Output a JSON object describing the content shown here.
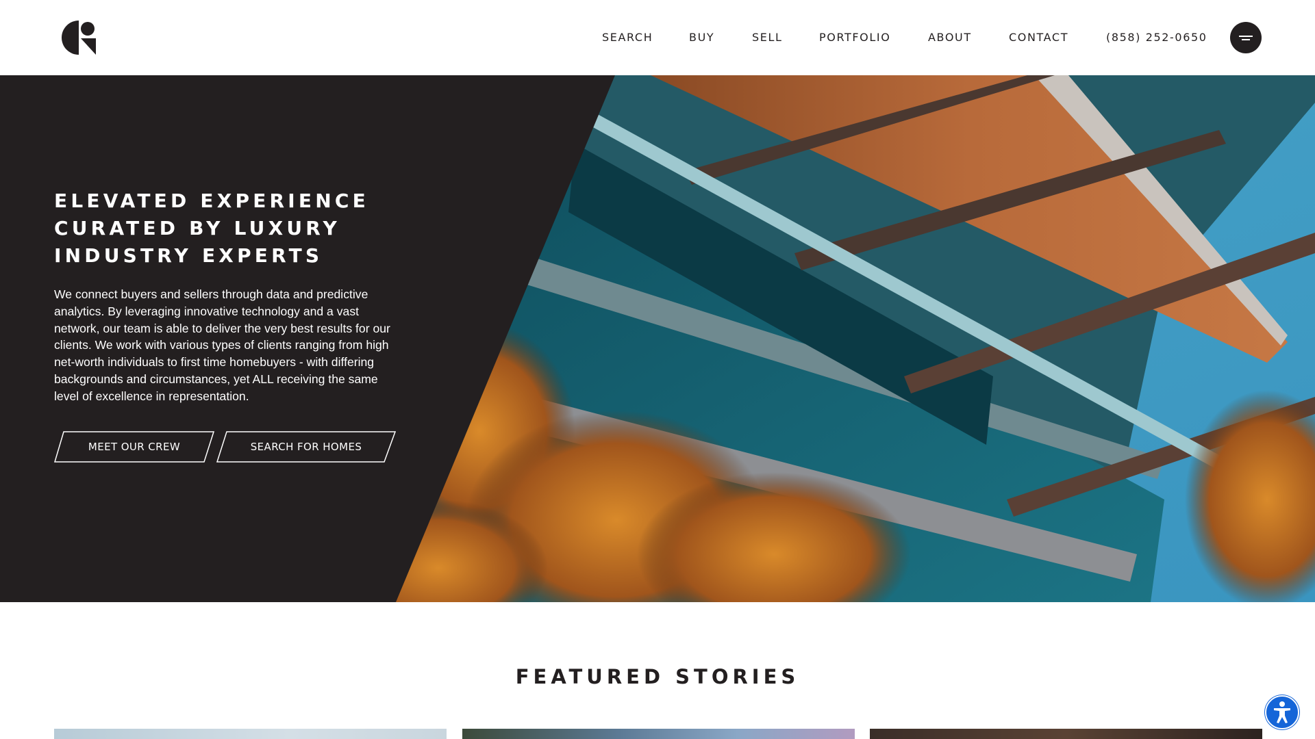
{
  "header": {
    "logo_name": "brand-logo",
    "nav": [
      {
        "label": "SEARCH"
      },
      {
        "label": "BUY"
      },
      {
        "label": "SELL"
      },
      {
        "label": "PORTFOLIO"
      },
      {
        "label": "ABOUT"
      },
      {
        "label": "CONTACT"
      },
      {
        "label": "(858) 252-0650"
      }
    ],
    "menu_icon": "menu-icon"
  },
  "hero": {
    "title_lines": [
      "ELEVATED EXPERIENCE",
      "CURATED BY LUXURY",
      "INDUSTRY EXPERTS"
    ],
    "body": "We connect buyers and sellers through data and predictive analytics. By leveraging innovative technology and a vast network, our team is able to deliver the very best results for our clients. We work with various types of clients ranging from high net-worth individuals to first time homebuyers - with differing backgrounds and circumstances, yet ALL receiving the same level of excellence in representation.",
    "buttons": {
      "crew": "MEET OUR CREW",
      "homes": "SEARCH FOR HOMES"
    }
  },
  "featured": {
    "title": "FEATURED STORIES"
  },
  "accessibility_icon": "accessibility-icon",
  "colors": {
    "dark": "#231f20",
    "accent_blue": "#1565d8",
    "white": "#ffffff"
  }
}
